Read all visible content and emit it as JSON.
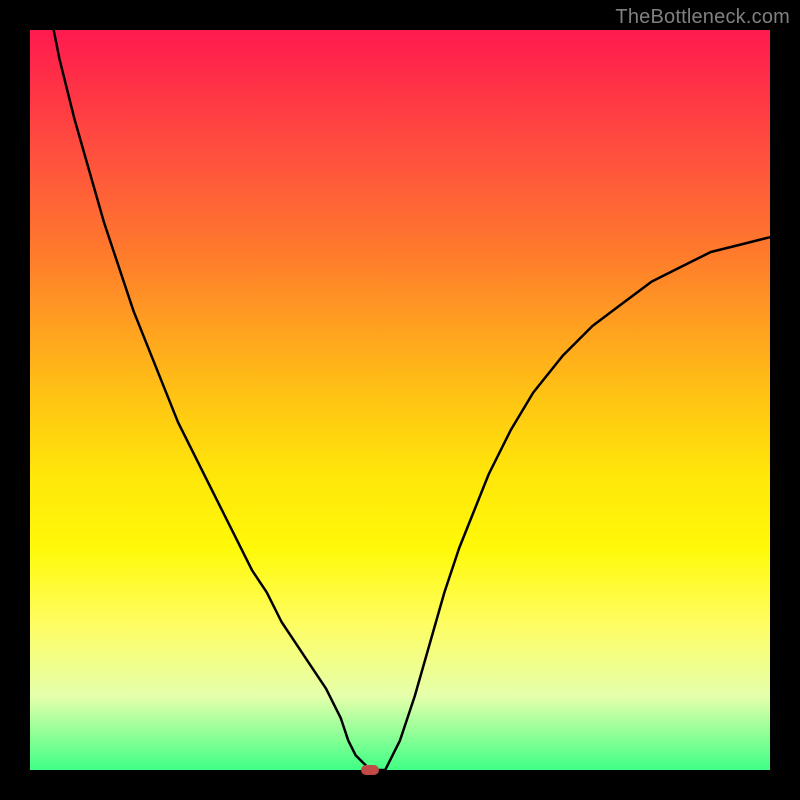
{
  "watermark": "TheBottleneck.com",
  "colors": {
    "frame_bg": "#000000",
    "curve_stroke": "#000000",
    "marker_fill": "#c04a45",
    "watermark_text": "#808080"
  },
  "chart_data": {
    "type": "line",
    "title": "",
    "xlabel": "",
    "ylabel": "",
    "xlim": [
      0,
      100
    ],
    "ylim": [
      0,
      100
    ],
    "x": [
      0,
      2,
      4,
      6,
      8,
      10,
      12,
      14,
      16,
      18,
      20,
      22,
      24,
      26,
      28,
      30,
      32,
      34,
      36,
      38,
      40,
      42,
      43,
      44,
      45,
      46,
      48,
      50,
      52,
      54,
      56,
      58,
      60,
      62,
      65,
      68,
      72,
      76,
      80,
      84,
      88,
      92,
      96,
      100
    ],
    "values": [
      118,
      106,
      96,
      88,
      81,
      74,
      68,
      62,
      57,
      52,
      47,
      43,
      39,
      35,
      31,
      27,
      24,
      20,
      17,
      14,
      11,
      7,
      4,
      2,
      1,
      0,
      0,
      4,
      10,
      17,
      24,
      30,
      35,
      40,
      46,
      51,
      56,
      60,
      63,
      66,
      68,
      70,
      71,
      72
    ],
    "marker": {
      "x": 46,
      "y": 0
    },
    "gradient_stops": [
      {
        "pct": 0,
        "color": "#ff1a4e"
      },
      {
        "pct": 10,
        "color": "#ff3a44"
      },
      {
        "pct": 20,
        "color": "#ff5a3a"
      },
      {
        "pct": 30,
        "color": "#ff7a2c"
      },
      {
        "pct": 40,
        "color": "#ffa020"
      },
      {
        "pct": 50,
        "color": "#ffc513"
      },
      {
        "pct": 60,
        "color": "#ffe60a"
      },
      {
        "pct": 70,
        "color": "#fff908"
      },
      {
        "pct": 80,
        "color": "#fffd60"
      },
      {
        "pct": 90,
        "color": "#e5ffab"
      },
      {
        "pct": 100,
        "color": "#3fff85"
      }
    ]
  }
}
